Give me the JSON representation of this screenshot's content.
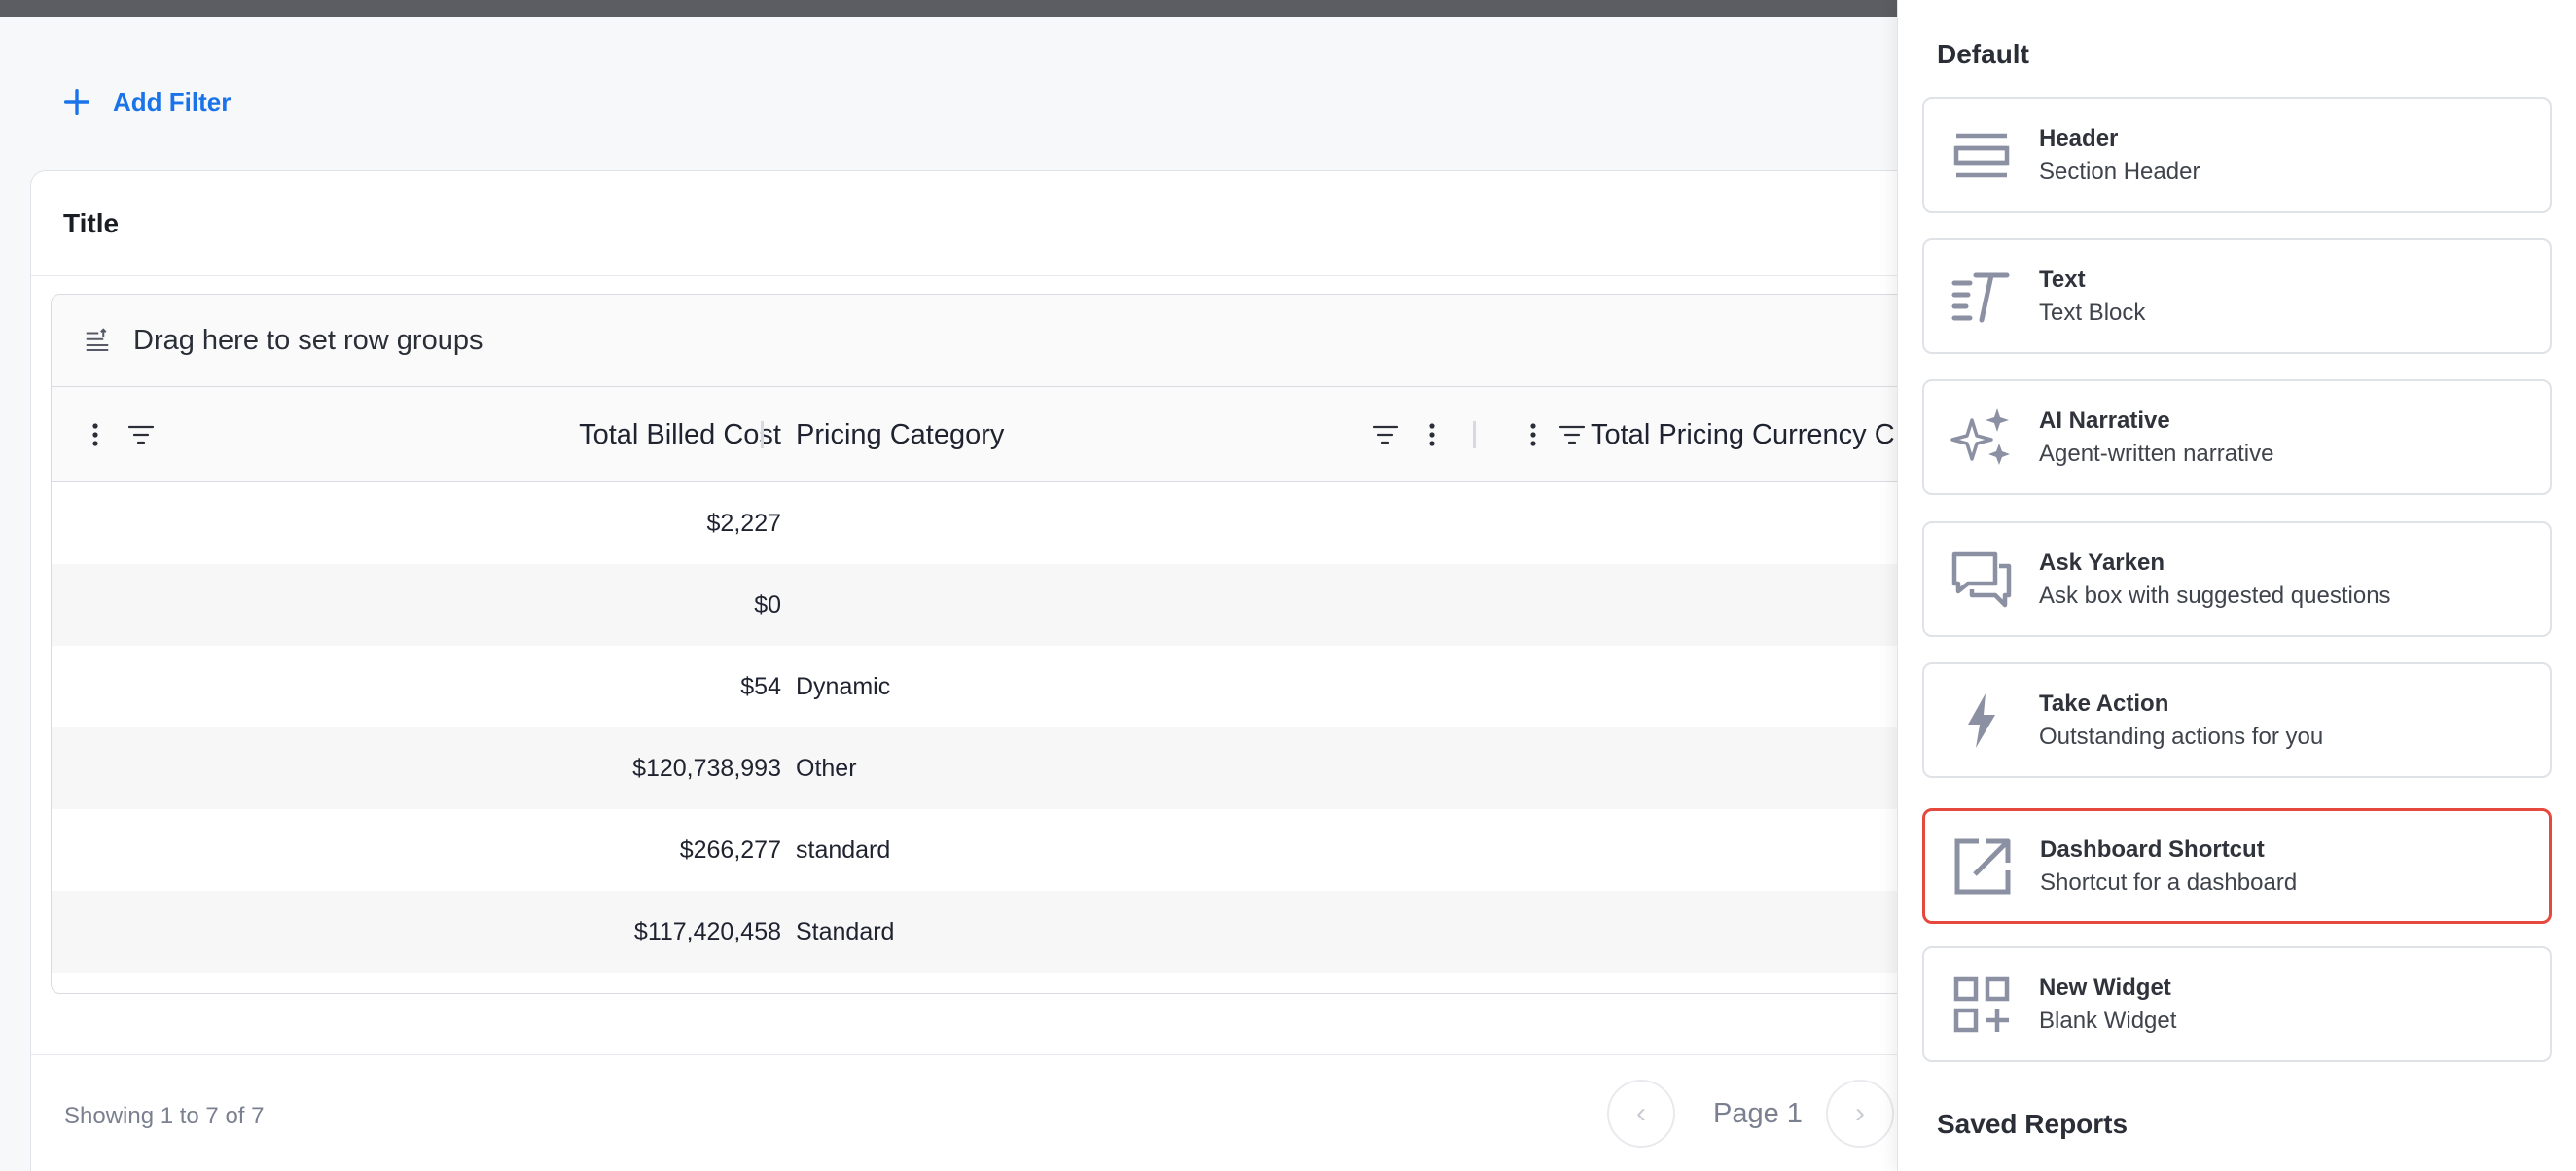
{
  "filters": {
    "add_label": "Add Filter"
  },
  "card": {
    "title": "Title",
    "group_bar_label": "Drag here to set row groups",
    "columns": [
      "Total Billed Cost",
      "Pricing Category",
      "Total Pricing Currency C"
    ],
    "rows": [
      {
        "cost": "$2,227",
        "category": ""
      },
      {
        "cost": "$0",
        "category": ""
      },
      {
        "cost": "$54",
        "category": "Dynamic"
      },
      {
        "cost": "$120,738,993",
        "category": "Other"
      },
      {
        "cost": "$266,277",
        "category": "standard"
      },
      {
        "cost": "$117,420,458",
        "category": "Standard"
      }
    ],
    "showing": "Showing 1 to 7 of 7",
    "page_label": "Page 1"
  },
  "panel": {
    "default_heading": "Default",
    "saved_heading": "Saved Reports",
    "widgets": [
      {
        "title": "Header",
        "subtitle": "Section Header",
        "icon": "header-icon"
      },
      {
        "title": "Text",
        "subtitle": "Text Block",
        "icon": "text-icon"
      },
      {
        "title": "AI Narrative",
        "subtitle": "Agent-written narrative",
        "icon": "sparkles-icon"
      },
      {
        "title": "Ask Yarken",
        "subtitle": "Ask box with suggested questions",
        "icon": "chat-icon"
      },
      {
        "title": "Take Action",
        "subtitle": "Outstanding actions for you",
        "icon": "bolt-icon"
      },
      {
        "title": "Dashboard Shortcut",
        "subtitle": "Shortcut for a dashboard",
        "icon": "external-link-icon",
        "selected": true
      },
      {
        "title": "New Widget",
        "subtitle": "Blank Widget",
        "icon": "grid-plus-icon"
      }
    ]
  },
  "colors": {
    "accent": "#1a73e8",
    "selection": "#e5483d",
    "icon": "#8c90a3"
  }
}
